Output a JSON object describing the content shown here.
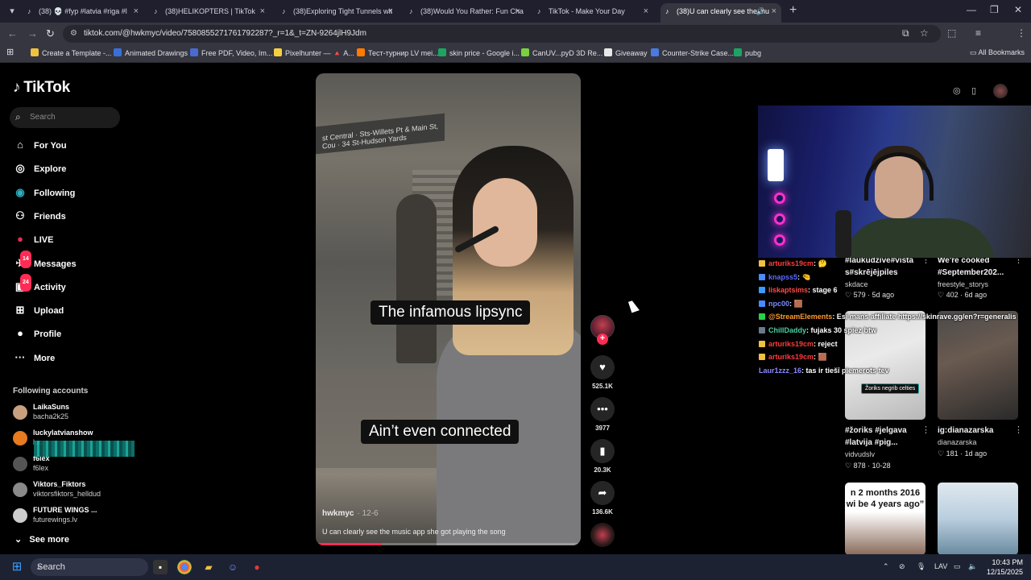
{
  "browser": {
    "tabs": [
      {
        "label": "(38) 💀 #fyp #latvia #riga #l",
        "active": false
      },
      {
        "label": "(38)HELIKOPTERS | TikTok",
        "active": false
      },
      {
        "label": "(38)Exploring Tight Tunnels wit",
        "active": false
      },
      {
        "label": "(38)Would You Rather: Fun Cha",
        "active": false
      },
      {
        "label": "TikTok - Make Your Day",
        "active": false
      },
      {
        "label": "(38)U can clearly see the mu",
        "active": true
      }
    ],
    "url": "tiktok.com/@hwkmyc/video/7580855271761792287?_r=1&_t=ZN-9264jlH9Jdm",
    "bookmarks": [
      {
        "label": "Create a Template -...",
        "color": "#f0c040"
      },
      {
        "label": "Animated Drawings",
        "color": "#3b6fd8"
      },
      {
        "label": "Free PDF, Video, Im...",
        "color": "#4a6ad0"
      },
      {
        "label": "Pixelhunter — 🔺 A...",
        "color": "#f4d040"
      },
      {
        "label": "Тест-турнир LV mei...",
        "color": "#ff7a00"
      },
      {
        "label": "skin price - Google i...",
        "color": "#1da462"
      },
      {
        "label": "CanUV...pyD 3D Re...",
        "color": "#7ad040"
      },
      {
        "label": "Giveaway",
        "color": "#e8e8e8"
      },
      {
        "label": "Counter-Strike Case...",
        "color": "#4a7ae0"
      },
      {
        "label": "pubg",
        "color": "#1da462"
      }
    ],
    "all_bookmarks": "All Bookmarks"
  },
  "sidebar": {
    "logo": "TikTok",
    "search_placeholder": "Search",
    "nav": [
      {
        "label": "For You",
        "icon": "home-icon"
      },
      {
        "label": "Explore",
        "icon": "compass-icon"
      },
      {
        "label": "Following",
        "icon": "following-icon"
      },
      {
        "label": "Friends",
        "icon": "friends-icon"
      },
      {
        "label": "LIVE",
        "icon": "live-icon"
      },
      {
        "label": "Messages",
        "icon": "messages-icon",
        "badge": "14"
      },
      {
        "label": "Activity",
        "icon": "activity-icon",
        "badge": "24"
      },
      {
        "label": "Upload",
        "icon": "upload-icon"
      },
      {
        "label": "Profile",
        "icon": "profile-icon"
      },
      {
        "label": "More",
        "icon": "more-icon"
      }
    ],
    "following_title": "Following accounts",
    "accounts": [
      {
        "name": "LaikaSuns",
        "handle": "bacha2k25",
        "color": "#c8a080"
      },
      {
        "name": "luckylatvianshow",
        "handle": "luc",
        "color": "#e87a20"
      },
      {
        "name": "f6lex",
        "handle": "f6lex",
        "color": "#555"
      },
      {
        "name": "Viktors_Fiktors",
        "handle": "viktorsfiktors_helldud",
        "color": "#8a8a8a"
      },
      {
        "name": "FUTURE WINGS ...",
        "handle": "futurewings.lv",
        "color": "#cccccc"
      }
    ],
    "see_more": "See more"
  },
  "video": {
    "sign": "st Central · Sts-Willets Pt & Main St, Cou · 34 St-Hudson Yards",
    "caption_top": "The infamous lipsync",
    "caption_bottom": "Ain’t even connected",
    "author": "hwkmyc",
    "date": "· 12-6",
    "description": "U can clearly see the music app she got playing the song",
    "progress": 0.25
  },
  "actions": {
    "likes": "525.1K",
    "comments": "3977",
    "saves": "20.3K",
    "shares": "136.6K"
  },
  "chat": [
    {
      "user": "arturiks19cm",
      "msg": ": 🤔",
      "color": "#ff3b3b",
      "badge": "#f0c040"
    },
    {
      "user": "knapss5",
      "msg": ": 🤏",
      "color": "#5a6aff",
      "badge": "#4a8aff"
    },
    {
      "user": "liskaptsims",
      "msg": ": stage 6",
      "color": "#ff4a4a",
      "badge": "#3a9aff"
    },
    {
      "user": "npc00",
      "msg": ": 🟫",
      "color": "#7a8aff",
      "badge": "#4a8aff"
    },
    {
      "user": "@StreamElements",
      "msg": ": Esi mans affiliate https://skinrave.gg/en?r=generalis",
      "color": "#ff9a2a",
      "badge": "#2ad04a"
    },
    {
      "user": "ChillDaddy",
      "msg": ": fujaks 30 spiez btw",
      "color": "#4ad0a0",
      "badge": "#6a7a8a"
    },
    {
      "user": "arturiks19cm",
      "msg": ": reject",
      "color": "#ff3b3b",
      "badge": "#f0c040"
    },
    {
      "user": "arturiks19cm",
      "msg": ": 🟫",
      "color": "#ff3b3b",
      "badge": "#f0c040"
    },
    {
      "user": "Laur1zzz_16",
      "msg": ": tas ir tiešī piemerots tev",
      "color": "#8a8aff",
      "badge": ""
    }
  ],
  "cards": [
    {
      "title1": "#laukudzive#vista",
      "title2": "s#skrējējpiles",
      "user": "skdace",
      "likes": "579",
      "age": "5d ago"
    },
    {
      "title1": "We're cooked",
      "title2": "#September202...",
      "user": "freestyle_storys",
      "likes": "402",
      "age": "6d ago"
    },
    {
      "title1": "#žoriks #jelgava",
      "title2": "#latvija #pig...",
      "user": "vidvudslv",
      "likes": "878",
      "age": "10-28",
      "thumb_label": "Žoriks negrib celties"
    },
    {
      "title1": "ig:dianazarska",
      "title2": "",
      "user": "dianazarska",
      "likes": "181",
      "age": "1d ago"
    },
    {
      "quote": "n 2 months 2016 wi be 4 years ago”"
    },
    {}
  ],
  "taskbar": {
    "search": "Search",
    "lang": "LAV",
    "time": "10:43 PM",
    "date": "12/15/2025"
  }
}
